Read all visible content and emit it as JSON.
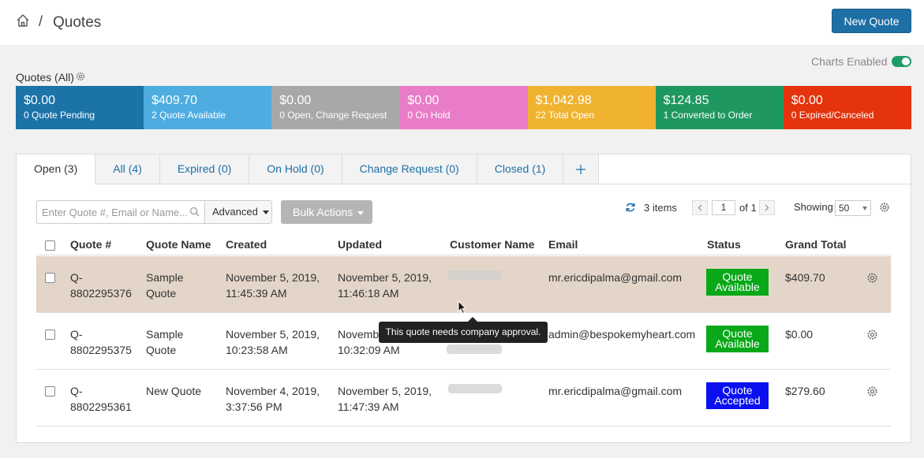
{
  "breadcrumb": {
    "separator": "/",
    "title": "Quotes"
  },
  "header": {
    "new_quote_label": "New Quote"
  },
  "charts": {
    "label": "Charts Enabled",
    "enabled": true
  },
  "quotes_label": "Quotes (All)",
  "summary_tiles": [
    {
      "value": "$0.00",
      "label": "0 Quote Pending",
      "color": "#1c73a8"
    },
    {
      "value": "$409.70",
      "label": "2 Quote Available",
      "color": "#4eace0"
    },
    {
      "value": "$0.00",
      "label": "0 Open, Change Request",
      "color": "#a8a8a8"
    },
    {
      "value": "$0.00",
      "label": "0 On Hold",
      "color": "#e97cc8"
    },
    {
      "value": "$1,042.98",
      "label": "22 Total Open",
      "color": "#f0b330"
    },
    {
      "value": "$124.85",
      "label": "1 Converted to Order",
      "color": "#1f9860"
    },
    {
      "value": "$0.00",
      "label": "0 Expired/Canceled",
      "color": "#e4330d"
    }
  ],
  "tabs": [
    {
      "label": "Open (3)",
      "active": true
    },
    {
      "label": "All (4)",
      "active": false
    },
    {
      "label": "Expired (0)",
      "active": false
    },
    {
      "label": "On Hold (0)",
      "active": false
    },
    {
      "label": "Change Request (0)",
      "active": false
    },
    {
      "label": "Closed (1)",
      "active": false
    }
  ],
  "toolbar": {
    "search_placeholder": "Enter Quote #, Email or Name...",
    "advanced_label": "Advanced",
    "bulk_label": "Bulk Actions",
    "items_count": "3 items",
    "page_current": "1",
    "page_of": "of 1",
    "showing_label": "Showing",
    "per_page": "50"
  },
  "table": {
    "columns": [
      "Quote #",
      "Quote Name",
      "Created",
      "Updated",
      "Customer Name",
      "Email",
      "Status",
      "Grand Total"
    ],
    "rows": [
      {
        "quote_no": [
          "Q-",
          "8802295376"
        ],
        "name": [
          "Sample",
          "Quote"
        ],
        "created": [
          "November 5, 2019,",
          "11:45:39 AM"
        ],
        "updated": [
          "November 5, 2019,",
          "11:46:18 AM"
        ],
        "email": "mr.ericdipalma@gmail.com",
        "status": [
          "Quote",
          "Available"
        ],
        "status_color": "#08a818",
        "total": "$409.70",
        "highlighted": true
      },
      {
        "quote_no": [
          "Q-",
          "8802295375"
        ],
        "name": [
          "Sample",
          "Quote"
        ],
        "created": [
          "November 5, 2019,",
          "10:23:58 AM"
        ],
        "updated": [
          "Novembe",
          "10:32:09 AM"
        ],
        "email": "admin@bespokemyheart.com",
        "status": [
          "Quote",
          "Available"
        ],
        "status_color": "#08a818",
        "total": "$0.00",
        "highlighted": false
      },
      {
        "quote_no": [
          "Q-",
          "8802295361"
        ],
        "name": [
          "New Quote",
          ""
        ],
        "created": [
          "November 4, 2019,",
          "3:37:56 PM"
        ],
        "updated": [
          "November 5, 2019,",
          "11:47:39 AM"
        ],
        "email": "mr.ericdipalma@gmail.com",
        "status": [
          "Quote",
          "Accepted"
        ],
        "status_color": "#0a10f0",
        "total": "$279.60",
        "highlighted": false
      }
    ]
  },
  "tooltip": "This quote needs company approval.",
  "icons": [
    "home-icon",
    "gear-icon",
    "search-icon",
    "refresh-icon",
    "chevron-left-icon",
    "chevron-right-icon",
    "plus-icon",
    "cursor-icon"
  ]
}
